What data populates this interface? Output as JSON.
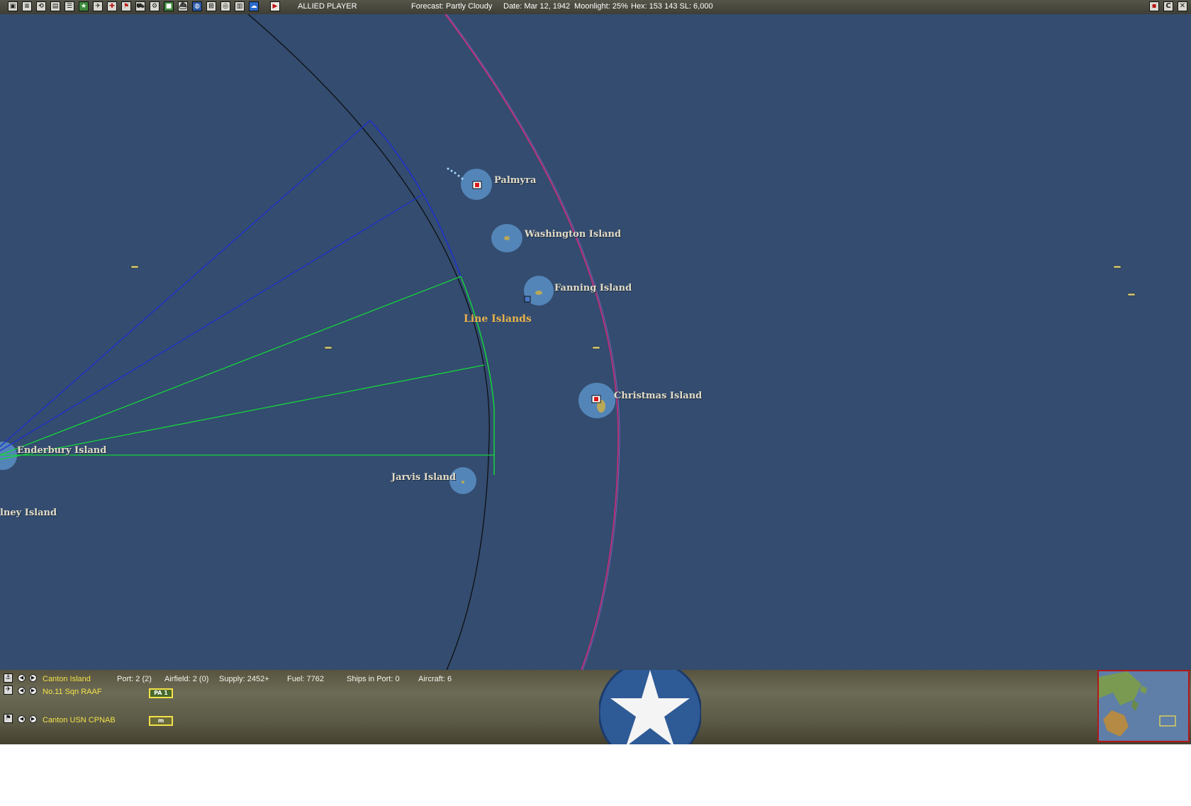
{
  "topbar": {
    "player": "ALLIED PLAYER",
    "forecast": "Forecast: Partly Cloudy",
    "date": "Date: Mar 12, 1942",
    "moonlight": "Moonlight: 25%",
    "hex": "Hex: 153 143  SL: 6,000",
    "icons": [
      "menu-icon",
      "report-icon",
      "replay-icon",
      "print-icon",
      "list-icon",
      "info-icon",
      "star-icon",
      "airgroup-icon",
      "aircraft-icon",
      "flag-icon",
      "cargo-icon",
      "lcu-icon",
      "base-icon",
      "ship-icon",
      "globe-icon",
      "formation-icon",
      "ob-icon",
      "chart-icon",
      "weather-icon",
      "end-turn-icon"
    ],
    "window_buttons": [
      "minimize-icon",
      "restore-icon",
      "close-icon"
    ]
  },
  "map": {
    "region_label": "Line Islands",
    "places": {
      "palmyra": "Palmyra",
      "washington": "Washington Island",
      "fanning": "Fanning Island",
      "christmas": "Christmas Island",
      "enderbury": "Enderbury Island",
      "jarvis": "Jarvis Island",
      "sidney": "lney Island"
    }
  },
  "panel": {
    "base": {
      "name": "Canton Island",
      "port": "Port: 2 (2)",
      "airfield": "Airfield: 2 (0)",
      "supply": "Supply: 2452+",
      "fuel": "Fuel: 7762",
      "ships": "Ships in Port: 0",
      "aircraft": "Aircraft: 6"
    },
    "air_unit": {
      "name": "No.11 Sqn RAAF",
      "badge": "PA 1"
    },
    "ground_unit": {
      "name": "Canton USN CPNAB",
      "badge": "m"
    },
    "emblem": "us-star-roundel-icon"
  },
  "colors": {
    "sea": "#334c6f",
    "range_blue": "#1f2fd0",
    "range_green": "#16d43c",
    "range_magenta": "#d42a78",
    "label_yellow": "#f2e14a",
    "region_orange": "#e7b14a"
  }
}
